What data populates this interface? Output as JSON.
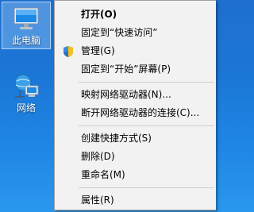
{
  "desktop": {
    "icons": [
      {
        "label": "此电脑",
        "icon": "computer-icon"
      },
      {
        "label": "网络",
        "icon": "network-icon"
      }
    ]
  },
  "context_menu": {
    "open": "打开(O)",
    "pin_quick_access": "固定到“快速访问”",
    "manage": "管理(G)",
    "manage_icon": "uac-shield-icon",
    "pin_start": "固定到“开始”屏幕(P)",
    "map_drive": "映射网络驱动器(N)...",
    "disconnect_drive": "断开网络驱动器的连接(C)...",
    "create_shortcut": "创建快捷方式(S)",
    "delete": "删除(D)",
    "rename": "重命名(M)",
    "properties": "属性(R)"
  }
}
